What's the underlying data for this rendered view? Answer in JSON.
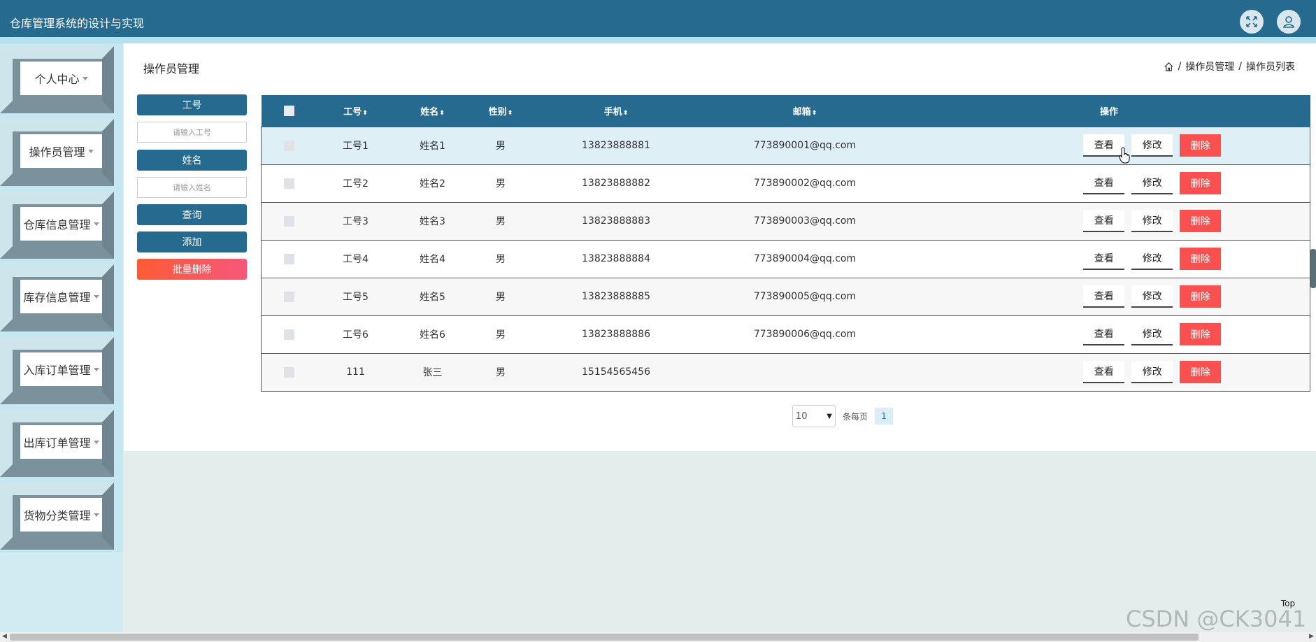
{
  "header": {
    "title": "仓库管理系统的设计与实现"
  },
  "sidebar": {
    "items": [
      {
        "label": "个人中心"
      },
      {
        "label": "操作员管理"
      },
      {
        "label": "仓库信息管理"
      },
      {
        "label": "库存信息管理"
      },
      {
        "label": "入库订单管理"
      },
      {
        "label": "出库订单管理"
      },
      {
        "label": "货物分类管理"
      }
    ]
  },
  "page": {
    "title": "操作员管理",
    "breadcrumb": [
      "操作员管理",
      "操作员列表"
    ]
  },
  "search": {
    "gonghao_label": "工号",
    "gonghao_placeholder": "请输入工号",
    "name_label": "姓名",
    "name_placeholder": "请输入姓名",
    "query_label": "查询",
    "add_label": "添加",
    "batch_delete_label": "批量删除"
  },
  "table": {
    "columns": [
      "工号",
      "姓名",
      "性别",
      "手机",
      "邮箱",
      "操作"
    ],
    "actions": {
      "view": "查看",
      "edit": "修改",
      "delete": "删除"
    },
    "rows": [
      {
        "gonghao": "工号1",
        "name": "姓名1",
        "gender": "男",
        "phone": "13823888881",
        "email": "773890001@qq.com"
      },
      {
        "gonghao": "工号2",
        "name": "姓名2",
        "gender": "男",
        "phone": "13823888882",
        "email": "773890002@qq.com"
      },
      {
        "gonghao": "工号3",
        "name": "姓名3",
        "gender": "男",
        "phone": "13823888883",
        "email": "773890003@qq.com"
      },
      {
        "gonghao": "工号4",
        "name": "姓名4",
        "gender": "男",
        "phone": "13823888884",
        "email": "773890004@qq.com"
      },
      {
        "gonghao": "工号5",
        "name": "姓名5",
        "gender": "男",
        "phone": "13823888885",
        "email": "773890005@qq.com"
      },
      {
        "gonghao": "工号6",
        "name": "姓名6",
        "gender": "男",
        "phone": "13823888886",
        "email": "773890006@qq.com"
      },
      {
        "gonghao": "111",
        "name": "张三",
        "gender": "男",
        "phone": "15154565456",
        "email": ""
      }
    ]
  },
  "pagination": {
    "page_size": "10",
    "per_page_label": "条每页",
    "current_page": "1"
  },
  "top_button": "Top",
  "watermark": "CSDN @CK3041",
  "colors": {
    "primary": "#266a8f",
    "danger": "#fa5050",
    "header_strip": "#b5e0f0"
  }
}
